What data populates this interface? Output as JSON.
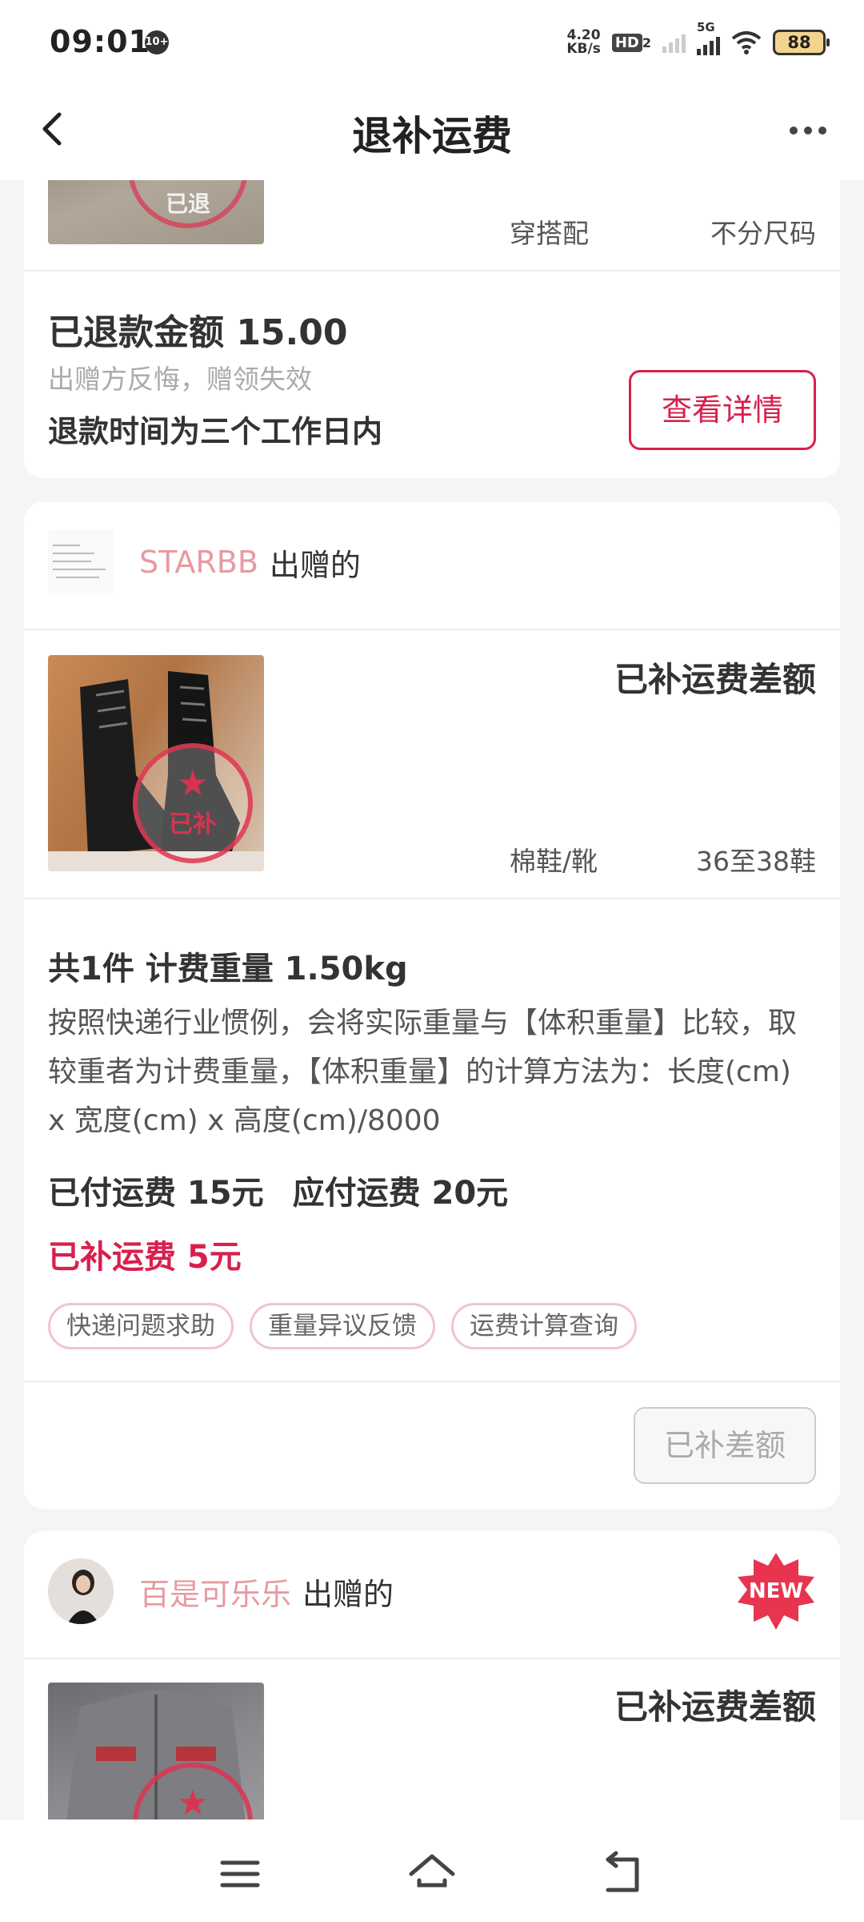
{
  "status_bar": {
    "time": "09:01",
    "notification_count": "10+",
    "net_speed_value": "4.20",
    "net_speed_unit": "KB/s",
    "hd_label": "HD",
    "hd_sub": "2",
    "network_label": "5G",
    "battery": "88"
  },
  "nav": {
    "title": "退补运费"
  },
  "card1": {
    "meta_style": "穿搭配",
    "meta_size": "不分尺码",
    "stamp_text": "已退",
    "refund_amount": "已退款金额 15.00",
    "reason": "出赠方反悔，赠领失效",
    "refund_time": "退款时间为三个工作日内",
    "detail_button": "查看详情"
  },
  "card2": {
    "sender_name": "STARBB",
    "sender_suffix": "出赠的",
    "status_label": "已补运费差额",
    "stamp_text": "已补",
    "meta_category": "棉鞋/靴",
    "meta_size": "36至38鞋",
    "weight_title": "共1件 计费重量 1.50kg",
    "description": "按照快递行业惯例，会将实际重量与【体积重量】比较，取较重者为计费重量，【体积重量】的计算方法为：长度(cm) x 宽度(cm) x 高度(cm)/8000",
    "paid_fee": "已付运费 15元",
    "due_fee": "应付运费 20元",
    "supplemented_fee": "已补运费 5元",
    "tags": [
      "快递问题求助",
      "重量异议反馈",
      "运费计算查询"
    ],
    "done_button": "已补差额"
  },
  "card3": {
    "sender_name": "百是可乐乐",
    "sender_suffix": "出赠的",
    "new_badge": "NEW",
    "status_label": "已补运费差额"
  },
  "colors": {
    "accent": "#d91f4d",
    "sender_name": "#e89aa0",
    "background": "#f5f5f5"
  },
  "icons": {
    "back": "back-arrow-icon",
    "more": "more-dots-icon",
    "menu": "menu-icon",
    "home": "home-icon",
    "return": "return-icon"
  }
}
